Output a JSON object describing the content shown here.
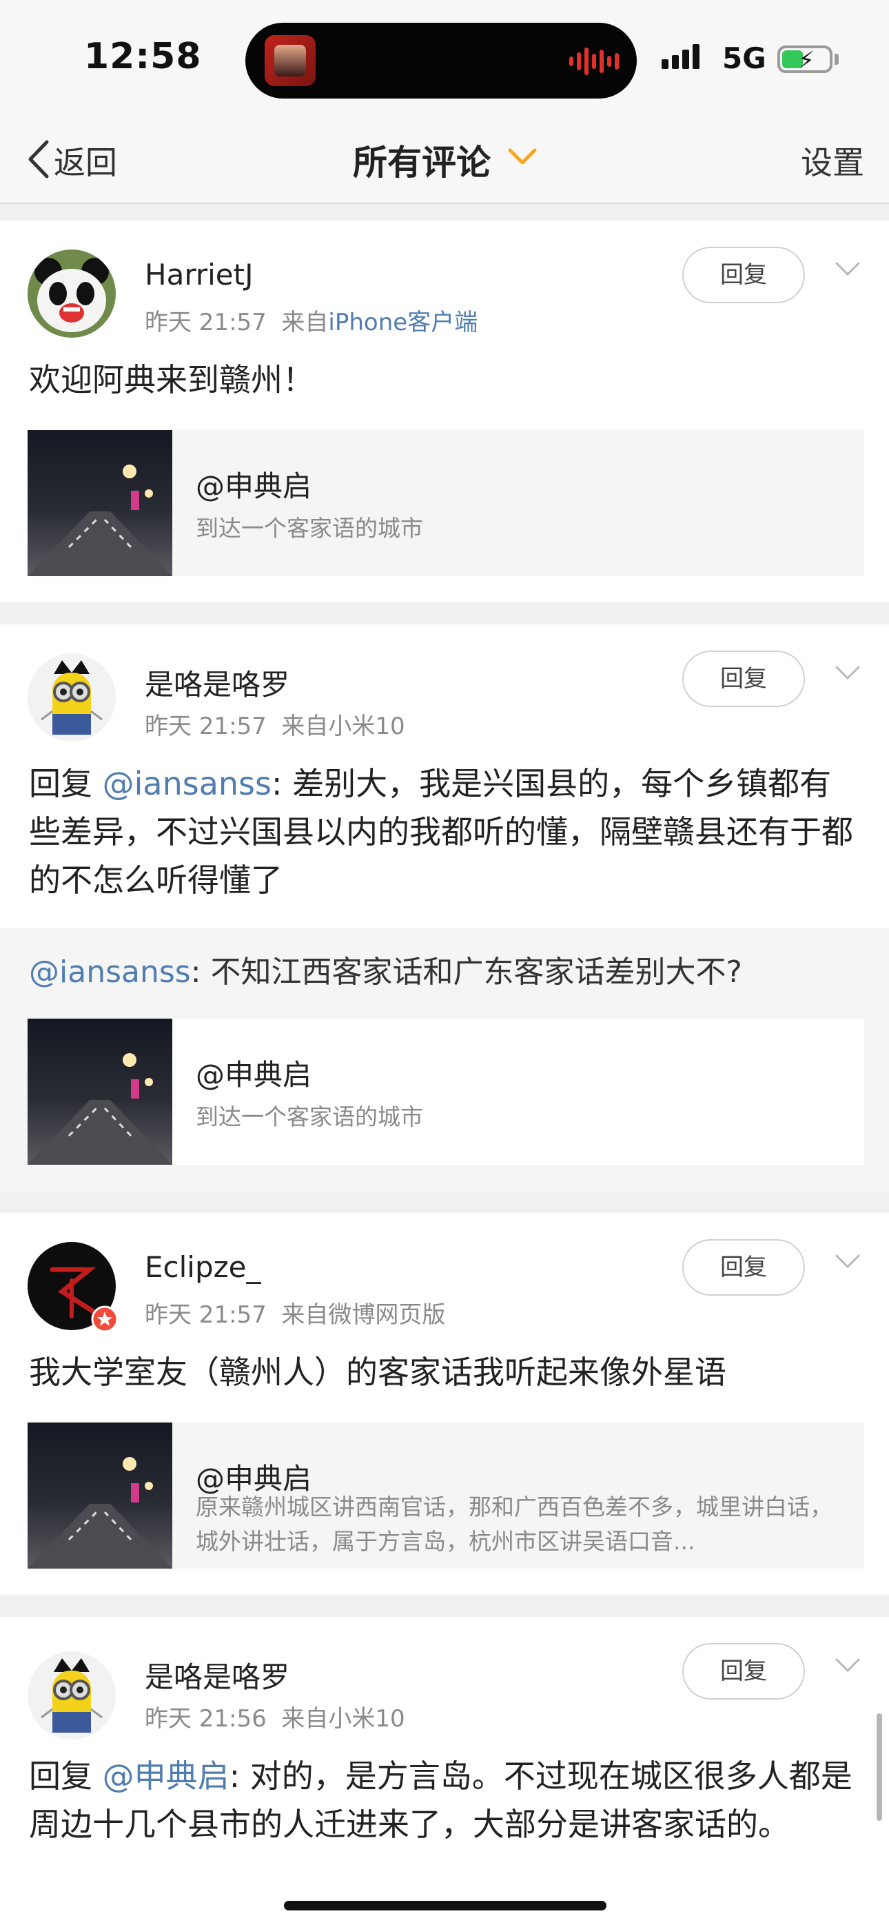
{
  "status_bar": {
    "time": "12:58",
    "network": "5G"
  },
  "nav": {
    "back_label": "返回",
    "title": "所有评论",
    "settings_label": "设置"
  },
  "comments": [
    {
      "username": "HarrietJ",
      "time": "昨天 21:57",
      "source_prefix": "来自",
      "source": "iPhone客户端",
      "reply_label": "回复",
      "text": "欢迎阿典来到赣州！",
      "link_card": {
        "title": "@申典启",
        "desc": "到达一个客家语的城市"
      }
    },
    {
      "username": "是咯是咯罗",
      "time": "昨天 21:57",
      "source": "来自小米10",
      "reply_label": "回复",
      "reply_prefix": "回复 ",
      "mention": "@iansanss",
      "text": ": 差别大，我是兴国县的，每个乡镇都有些差异，不过兴国县以内的我都听的懂，隔壁赣县还有于都的不怎么听得懂了",
      "quote": {
        "mention": "@iansanss",
        "text": ": 不知江西客家话和广东客家话差别大不?"
      },
      "link_card": {
        "title": "@申典启",
        "desc": "到达一个客家语的城市"
      }
    },
    {
      "username": "Eclipze_",
      "time": "昨天 21:57",
      "source": "来自微博网页版",
      "reply_label": "回复",
      "text": "我大学室友（赣州人）的客家话我听起来像外星语",
      "link_card": {
        "title": "@申典启",
        "desc": "原来赣州城区讲西南官话，那和广西百色差不多，城里讲白话，城外讲壮话，属于方言岛，杭州市区讲吴语口音..."
      }
    },
    {
      "username": "是咯是咯罗",
      "time": "昨天 21:56",
      "source": "来自小米10",
      "reply_label": "回复",
      "reply_prefix": "回复 ",
      "mention": "@申典启",
      "text": ": 对的，是方言岛。不过现在城区很多人都是周边十几个县市的人迁进来了，大部分是讲客家话的。"
    }
  ],
  "colors": {
    "link_blue": "#507daf",
    "accent_orange": "#f5a623",
    "battery_green": "#34c759",
    "divider_gray": "#f1f1f1"
  }
}
